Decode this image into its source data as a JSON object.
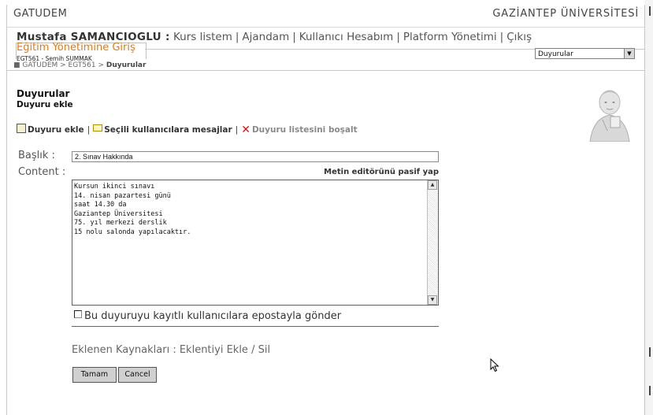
{
  "header": {
    "site_name": "GATUDEM",
    "university": "GAZİANTEP ÜNİVERSİTESİ"
  },
  "user_bar": {
    "user_name": "Mustafa SAMANCIOGLU :",
    "links": [
      "Kurs listem",
      "Ajandam",
      "Kullanıcı Hesabım",
      "Platform Yönetimi",
      "Çıkış"
    ]
  },
  "login_link": "Eğitim Yönetimine Giriş",
  "course_line": "EGT561 - Semih SUMMAK",
  "breadcrumb": {
    "prefix": "GATUDEM > EGT561 >",
    "current": "Duyurular"
  },
  "tool_select": {
    "selected": "Duyurular"
  },
  "section": {
    "title": "Duyurular",
    "subtitle": "Duyuru ekle"
  },
  "actions": {
    "add": "Duyuru ekle",
    "message": "Seçili kullanıcılara mesajlar",
    "clear": "Duyuru listesini boşalt"
  },
  "form": {
    "title_label": "Başlık :",
    "title_value": "2. Sınav Hakkında",
    "content_label": "Content :",
    "editor_toggle": "Metin editörünü pasif yap",
    "content_value": "Kursun ikinci sınavı\n14. nisan pazartesi günü\nsaat 14.30 da\nGaziantep Üniversitesi\n75. yıl merkezi derslik\n15 nolu salonda yapılacaktır.",
    "email_checkbox_label": "Bu duyuruyu kayıtlı kullanıcılara epostayla gönder",
    "email_checked": false,
    "attachments_label": "Eklenen Kaynakları :",
    "attachments_link": "Eklentiyi Ekle / Sil",
    "ok_button": "Tamam",
    "cancel_button": "Cancel"
  },
  "colors": {
    "login_link": "#e07b18",
    "clear_icon": "#dd1111"
  },
  "icons": {
    "add": "new-document-icon",
    "message": "envelope-icon",
    "clear": "red-x-icon",
    "avatar": "scholar-portrait-icon",
    "cursor": "mouse-pointer-icon"
  }
}
